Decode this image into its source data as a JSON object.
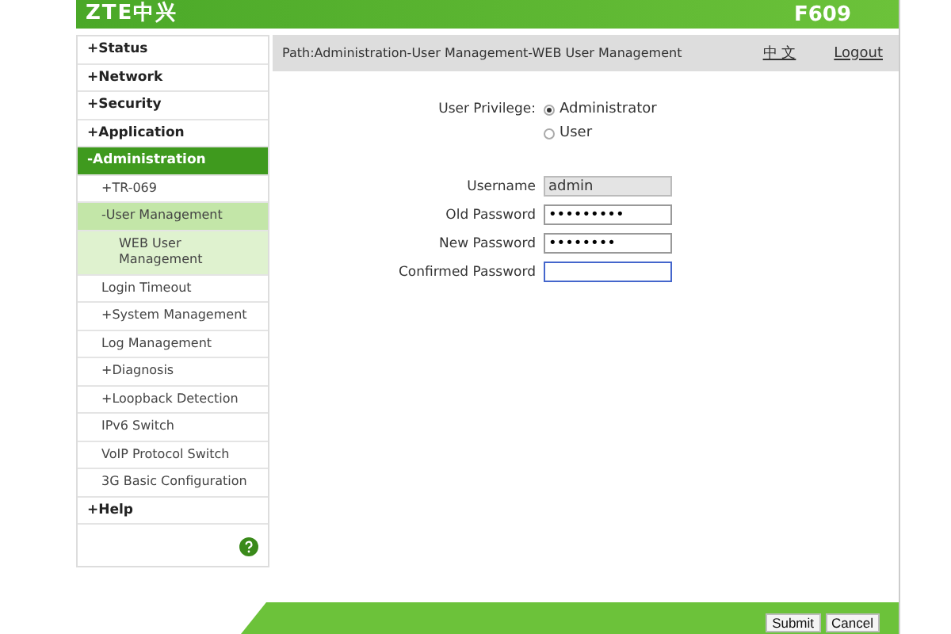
{
  "header": {
    "logo": "ZTE中兴",
    "model": "F609"
  },
  "menu": [
    {
      "label": "+Status",
      "selected": false
    },
    {
      "label": "+Network",
      "selected": false
    },
    {
      "label": "+Security",
      "selected": false
    },
    {
      "label": "+Application",
      "selected": false
    },
    {
      "label": "-Administration",
      "selected": true,
      "children": [
        {
          "label": "+TR-069",
          "selected": false
        },
        {
          "label": "-User Management",
          "selected": true,
          "children": [
            {
              "label": "WEB User Management",
              "selected": true
            }
          ]
        },
        {
          "label": "Login Timeout",
          "selected": false
        },
        {
          "label": "+System Management",
          "selected": false
        },
        {
          "label": "Log Management",
          "selected": false
        },
        {
          "label": "+Diagnosis",
          "selected": false
        },
        {
          "label": "+Loopback Detection",
          "selected": false
        },
        {
          "label": "IPv6 Switch",
          "selected": false
        },
        {
          "label": "VoIP Protocol Switch",
          "selected": false
        },
        {
          "label": "3G Basic Configuration",
          "selected": false
        }
      ]
    },
    {
      "label": "+Help",
      "selected": false
    }
  ],
  "path_bar": {
    "path": "Path:Administration-User Management-WEB User Management",
    "language_link": "中 文",
    "logout_link": "Logout"
  },
  "privilege": {
    "label": "User Privilege:",
    "options": [
      {
        "label": "Administrator",
        "selected": true
      },
      {
        "label": "User",
        "selected": false
      }
    ]
  },
  "fields": [
    {
      "label": "Username",
      "value": "admin",
      "disabled": true
    },
    {
      "label": "Old Password",
      "value": "•••••••••",
      "disabled": false
    },
    {
      "label": "New Password",
      "value": "••••••••",
      "disabled": false
    },
    {
      "label": "Confirmed Password",
      "disabled": false
    }
  ],
  "buttons": [
    "Submit",
    "Cancel"
  ]
}
